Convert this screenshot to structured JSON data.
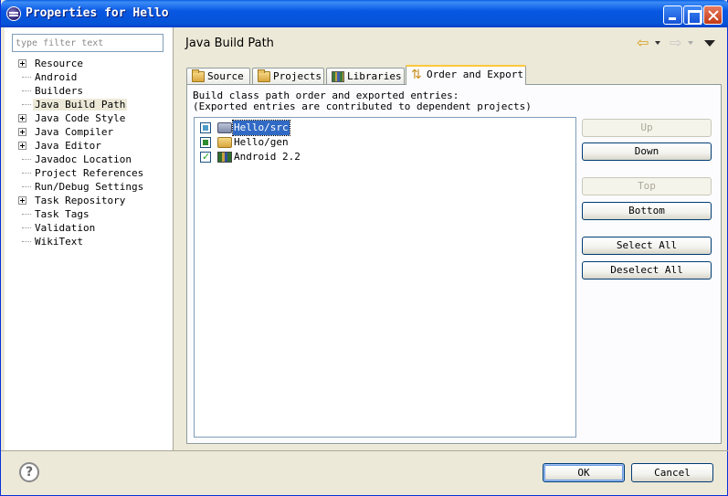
{
  "window": {
    "title": "Properties for Hello"
  },
  "filter": {
    "placeholder": "type filter text"
  },
  "tree": [
    {
      "label": "Resource",
      "expandable": true
    },
    {
      "label": "Android",
      "expandable": false
    },
    {
      "label": "Builders",
      "expandable": false
    },
    {
      "label": "Java Build Path",
      "expandable": false,
      "selected": true
    },
    {
      "label": "Java Code Style",
      "expandable": true
    },
    {
      "label": "Java Compiler",
      "expandable": true
    },
    {
      "label": "Java Editor",
      "expandable": true
    },
    {
      "label": "Javadoc Location",
      "expandable": false
    },
    {
      "label": "Project References",
      "expandable": false
    },
    {
      "label": "Run/Debug Settings",
      "expandable": false
    },
    {
      "label": "Task Repository",
      "expandable": true
    },
    {
      "label": "Task Tags",
      "expandable": false
    },
    {
      "label": "Validation",
      "expandable": false
    },
    {
      "label": "WikiText",
      "expandable": false
    }
  ],
  "page": {
    "title": "Java Build Path"
  },
  "tabs": [
    {
      "label": "Source",
      "icon": "source-folder-icon"
    },
    {
      "label": "Projects",
      "icon": "projects-folder-icon"
    },
    {
      "label": "Libraries",
      "icon": "libraries-icon"
    },
    {
      "label": "Order and Export",
      "icon": "order-export-icon",
      "active": true
    }
  ],
  "description": {
    "line1": "Build class path order and exported entries:",
    "line2": "(Exported entries are contributed to dependent projects)"
  },
  "entries": [
    {
      "label": "Hello/src",
      "state": "partial-grey",
      "selected": true,
      "icon": "source-folder-icon"
    },
    {
      "label": "Hello/gen",
      "state": "partial",
      "selected": false,
      "icon": "source-folder-icon"
    },
    {
      "label": "Android 2.2",
      "state": "checked",
      "selected": false,
      "icon": "library-icon"
    }
  ],
  "buttons": {
    "up": "Up",
    "down": "Down",
    "top": "Top",
    "bottom": "Bottom",
    "select_all": "Select All",
    "deselect_all": "Deselect All"
  },
  "dialog": {
    "ok": "OK",
    "cancel": "Cancel"
  },
  "colors": {
    "titlebar": "#0855dd",
    "selection": "#316ac5",
    "active_tab_accent": "#ffc83c"
  }
}
